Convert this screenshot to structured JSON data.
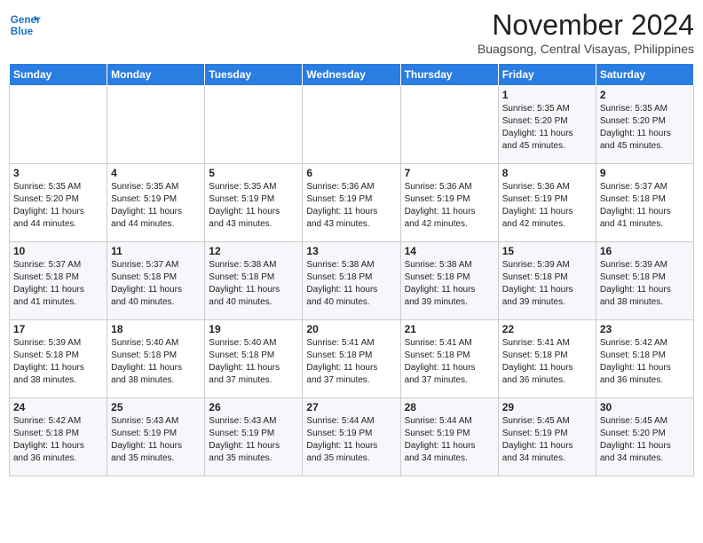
{
  "logo": {
    "line1": "General",
    "line2": "Blue"
  },
  "title": "November 2024",
  "location": "Buagsong, Central Visayas, Philippines",
  "days_of_week": [
    "Sunday",
    "Monday",
    "Tuesday",
    "Wednesday",
    "Thursday",
    "Friday",
    "Saturday"
  ],
  "weeks": [
    [
      {
        "day": "",
        "info": ""
      },
      {
        "day": "",
        "info": ""
      },
      {
        "day": "",
        "info": ""
      },
      {
        "day": "",
        "info": ""
      },
      {
        "day": "",
        "info": ""
      },
      {
        "day": "1",
        "info": "Sunrise: 5:35 AM\nSunset: 5:20 PM\nDaylight: 11 hours\nand 45 minutes."
      },
      {
        "day": "2",
        "info": "Sunrise: 5:35 AM\nSunset: 5:20 PM\nDaylight: 11 hours\nand 45 minutes."
      }
    ],
    [
      {
        "day": "3",
        "info": "Sunrise: 5:35 AM\nSunset: 5:20 PM\nDaylight: 11 hours\nand 44 minutes."
      },
      {
        "day": "4",
        "info": "Sunrise: 5:35 AM\nSunset: 5:19 PM\nDaylight: 11 hours\nand 44 minutes."
      },
      {
        "day": "5",
        "info": "Sunrise: 5:35 AM\nSunset: 5:19 PM\nDaylight: 11 hours\nand 43 minutes."
      },
      {
        "day": "6",
        "info": "Sunrise: 5:36 AM\nSunset: 5:19 PM\nDaylight: 11 hours\nand 43 minutes."
      },
      {
        "day": "7",
        "info": "Sunrise: 5:36 AM\nSunset: 5:19 PM\nDaylight: 11 hours\nand 42 minutes."
      },
      {
        "day": "8",
        "info": "Sunrise: 5:36 AM\nSunset: 5:19 PM\nDaylight: 11 hours\nand 42 minutes."
      },
      {
        "day": "9",
        "info": "Sunrise: 5:37 AM\nSunset: 5:18 PM\nDaylight: 11 hours\nand 41 minutes."
      }
    ],
    [
      {
        "day": "10",
        "info": "Sunrise: 5:37 AM\nSunset: 5:18 PM\nDaylight: 11 hours\nand 41 minutes."
      },
      {
        "day": "11",
        "info": "Sunrise: 5:37 AM\nSunset: 5:18 PM\nDaylight: 11 hours\nand 40 minutes."
      },
      {
        "day": "12",
        "info": "Sunrise: 5:38 AM\nSunset: 5:18 PM\nDaylight: 11 hours\nand 40 minutes."
      },
      {
        "day": "13",
        "info": "Sunrise: 5:38 AM\nSunset: 5:18 PM\nDaylight: 11 hours\nand 40 minutes."
      },
      {
        "day": "14",
        "info": "Sunrise: 5:38 AM\nSunset: 5:18 PM\nDaylight: 11 hours\nand 39 minutes."
      },
      {
        "day": "15",
        "info": "Sunrise: 5:39 AM\nSunset: 5:18 PM\nDaylight: 11 hours\nand 39 minutes."
      },
      {
        "day": "16",
        "info": "Sunrise: 5:39 AM\nSunset: 5:18 PM\nDaylight: 11 hours\nand 38 minutes."
      }
    ],
    [
      {
        "day": "17",
        "info": "Sunrise: 5:39 AM\nSunset: 5:18 PM\nDaylight: 11 hours\nand 38 minutes."
      },
      {
        "day": "18",
        "info": "Sunrise: 5:40 AM\nSunset: 5:18 PM\nDaylight: 11 hours\nand 38 minutes."
      },
      {
        "day": "19",
        "info": "Sunrise: 5:40 AM\nSunset: 5:18 PM\nDaylight: 11 hours\nand 37 minutes."
      },
      {
        "day": "20",
        "info": "Sunrise: 5:41 AM\nSunset: 5:18 PM\nDaylight: 11 hours\nand 37 minutes."
      },
      {
        "day": "21",
        "info": "Sunrise: 5:41 AM\nSunset: 5:18 PM\nDaylight: 11 hours\nand 37 minutes."
      },
      {
        "day": "22",
        "info": "Sunrise: 5:41 AM\nSunset: 5:18 PM\nDaylight: 11 hours\nand 36 minutes."
      },
      {
        "day": "23",
        "info": "Sunrise: 5:42 AM\nSunset: 5:18 PM\nDaylight: 11 hours\nand 36 minutes."
      }
    ],
    [
      {
        "day": "24",
        "info": "Sunrise: 5:42 AM\nSunset: 5:18 PM\nDaylight: 11 hours\nand 36 minutes."
      },
      {
        "day": "25",
        "info": "Sunrise: 5:43 AM\nSunset: 5:19 PM\nDaylight: 11 hours\nand 35 minutes."
      },
      {
        "day": "26",
        "info": "Sunrise: 5:43 AM\nSunset: 5:19 PM\nDaylight: 11 hours\nand 35 minutes."
      },
      {
        "day": "27",
        "info": "Sunrise: 5:44 AM\nSunset: 5:19 PM\nDaylight: 11 hours\nand 35 minutes."
      },
      {
        "day": "28",
        "info": "Sunrise: 5:44 AM\nSunset: 5:19 PM\nDaylight: 11 hours\nand 34 minutes."
      },
      {
        "day": "29",
        "info": "Sunrise: 5:45 AM\nSunset: 5:19 PM\nDaylight: 11 hours\nand 34 minutes."
      },
      {
        "day": "30",
        "info": "Sunrise: 5:45 AM\nSunset: 5:20 PM\nDaylight: 11 hours\nand 34 minutes."
      }
    ]
  ]
}
